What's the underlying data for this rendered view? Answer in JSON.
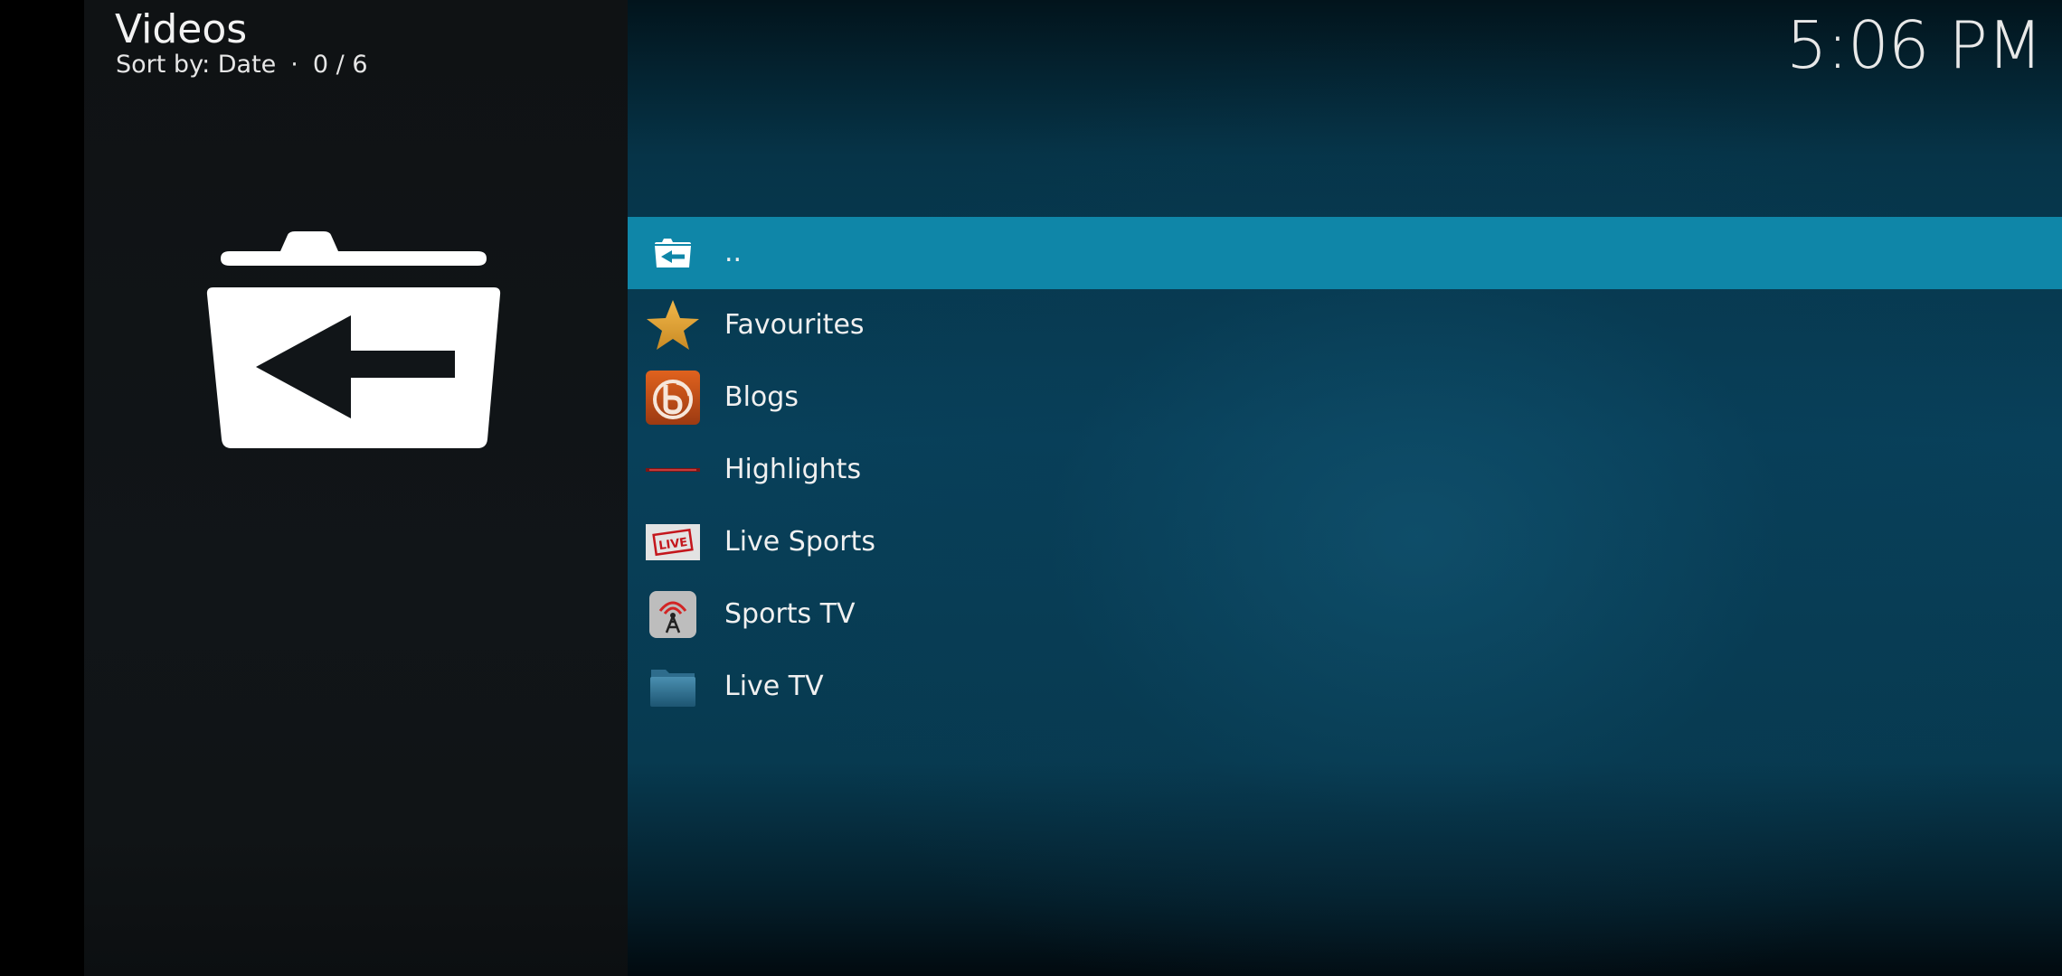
{
  "header": {
    "title": "Videos",
    "sort_label": "Sort by: Date",
    "separator": "·",
    "position": "0 / 6"
  },
  "clock": {
    "time": "5:06 PM"
  },
  "preview": {
    "icon": "folder-back-icon"
  },
  "list": {
    "items": [
      {
        "label": "..",
        "icon": "folder-back-icon",
        "selected": true
      },
      {
        "label": "Favourites",
        "icon": "star-icon"
      },
      {
        "label": "Blogs",
        "icon": "blogs-addon-icon"
      },
      {
        "label": "Highlights",
        "icon": "highlights-addon-icon"
      },
      {
        "label": "Live Sports",
        "icon": "live-sports-addon-icon"
      },
      {
        "label": "Sports TV",
        "icon": "sports-tv-addon-icon"
      },
      {
        "label": "Live TV",
        "icon": "folder-icon"
      }
    ]
  },
  "colors": {
    "selection": "#0f86a8",
    "background_teal": "#08405a",
    "panel_dark": "#111518"
  }
}
